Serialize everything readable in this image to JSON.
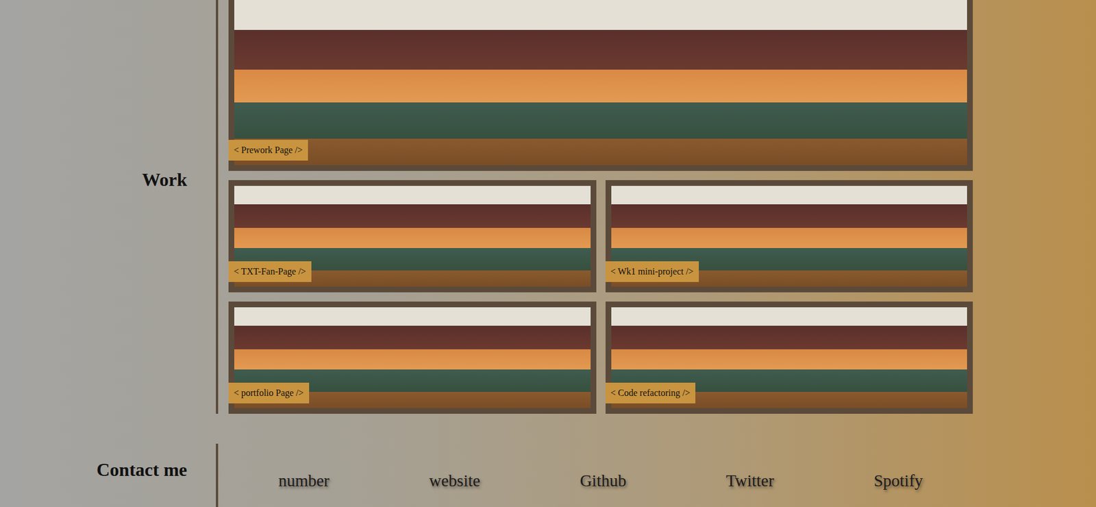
{
  "sections": {
    "work": "Work",
    "contact": "Contact me"
  },
  "work": [
    {
      "label": "< Prework Page />",
      "featured": true
    },
    {
      "label": "< TXT-Fan-Page />",
      "featured": false
    },
    {
      "label": "< Wk1 mini-project />",
      "featured": false
    },
    {
      "label": "< portfolio Page />",
      "featured": false
    },
    {
      "label": "< Code refactoring />",
      "featured": false
    }
  ],
  "contact": [
    "number",
    "website",
    "Github",
    "Twitter",
    "Spotify"
  ]
}
